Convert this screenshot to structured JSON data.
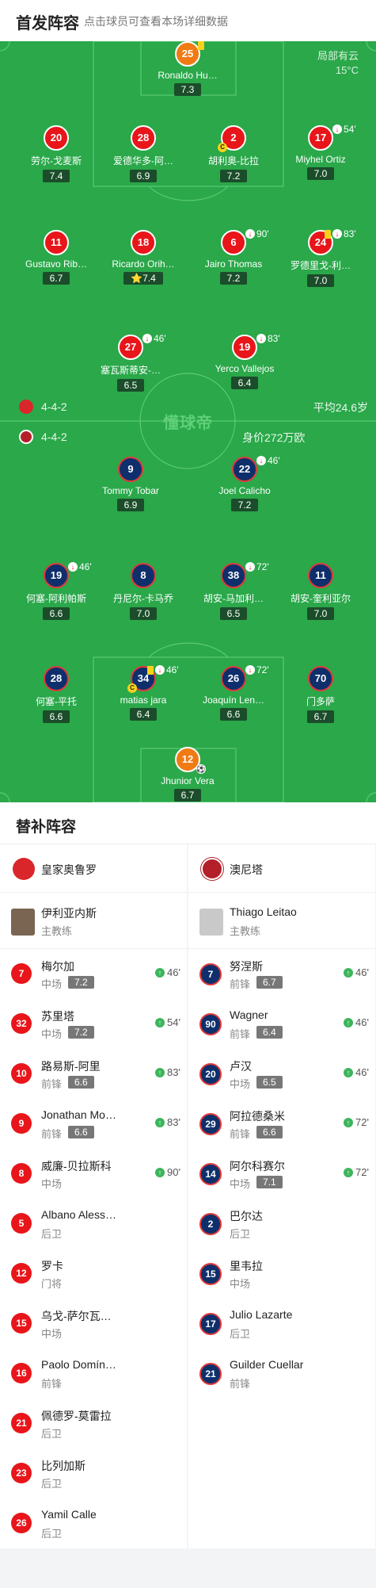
{
  "header": {
    "title": "首发阵容",
    "subtitle": "点击球员可查看本场详细数据"
  },
  "weather": {
    "line1": "局部有云",
    "line2": "15°C"
  },
  "home": {
    "formation": "4-4-2",
    "avg_age": "平均24.6岁",
    "crest_color": "#d9262b",
    "players": [
      {
        "num": "25",
        "name": "Ronaldo Hu…",
        "rating": "7.3",
        "color": "orange",
        "card": "yellow"
      },
      {
        "num": "20",
        "name": "劳尔-戈麦斯",
        "rating": "7.4",
        "color": "red"
      },
      {
        "num": "28",
        "name": "爱德华多-阿…",
        "rating": "6.9",
        "color": "red"
      },
      {
        "num": "2",
        "name": "胡利奥-比拉",
        "rating": "7.2",
        "color": "red",
        "captain": "C"
      },
      {
        "num": "17",
        "name": "Miyhel Ortiz",
        "rating": "7.0",
        "color": "red",
        "sub": "54'"
      },
      {
        "num": "11",
        "name": "Gustavo Rib…",
        "rating": "6.7",
        "color": "red"
      },
      {
        "num": "18",
        "name": "Ricardo Orih…",
        "rating": "7.4",
        "color": "red",
        "star": "⭐"
      },
      {
        "num": "6",
        "name": "Jairo Thomas",
        "rating": "7.2",
        "color": "red",
        "sub": "90'"
      },
      {
        "num": "24",
        "name": "罗德里戈-利…",
        "rating": "7.0",
        "color": "red",
        "sub": "83'",
        "card": "yellow"
      },
      {
        "num": "27",
        "name": "塞瓦斯蒂安-…",
        "rating": "6.5",
        "color": "red",
        "sub": "46'"
      },
      {
        "num": "19",
        "name": "Yerco Vallejos",
        "rating": "6.4",
        "color": "red",
        "sub": "83'"
      }
    ]
  },
  "away": {
    "formation": "4-4-2",
    "value": "身价272万欧",
    "crest_color": "#b3202a",
    "players": [
      {
        "num": "9",
        "name": "Tommy Tobar",
        "rating": "6.9"
      },
      {
        "num": "22",
        "name": "Joel Calicho",
        "rating": "7.2",
        "sub": "46'"
      },
      {
        "num": "19",
        "name": "何塞-阿利帕斯",
        "rating": "6.6",
        "sub": "46'"
      },
      {
        "num": "8",
        "name": "丹尼尔-卡马乔",
        "rating": "7.0"
      },
      {
        "num": "38",
        "name": "胡安-马加利…",
        "rating": "6.5",
        "sub": "72'"
      },
      {
        "num": "11",
        "name": "胡安-奎利亚尔",
        "rating": "7.0"
      },
      {
        "num": "28",
        "name": "何塞-平托",
        "rating": "6.6"
      },
      {
        "num": "34",
        "name": "matias jara",
        "rating": "6.4",
        "sub": "46'",
        "captain": "C",
        "card": "yellow"
      },
      {
        "num": "26",
        "name": "Joaquín Len…",
        "rating": "6.6",
        "sub": "72'"
      },
      {
        "num": "70",
        "name": "门多萨",
        "rating": "6.7"
      },
      {
        "num": "12",
        "name": "Jhunior Vera",
        "rating": "6.7",
        "color": "orange"
      }
    ]
  },
  "watermark": "懂球帝",
  "subs": {
    "title": "替补阵容",
    "home_team": "皇家奥鲁罗",
    "away_team": "澳尼塔",
    "home_coach": {
      "name": "伊利亚内斯",
      "role": "主教练"
    },
    "away_coach": {
      "name": "Thiago Leitao",
      "role": "主教练"
    },
    "home": [
      {
        "num": "7",
        "name": "梅尔加",
        "pos": "中场",
        "rating": "7.2",
        "event": "46'"
      },
      {
        "num": "32",
        "name": "苏里塔",
        "pos": "中场",
        "rating": "7.2",
        "event": "54'"
      },
      {
        "num": "10",
        "name": "路易斯-阿里",
        "pos": "前锋",
        "rating": "6.6",
        "event": "83'"
      },
      {
        "num": "9",
        "name": "Jonathan Mo…",
        "pos": "前锋",
        "rating": "6.6",
        "event": "83'"
      },
      {
        "num": "8",
        "name": "威廉-贝拉斯科",
        "pos": "中场",
        "rating": "",
        "event": "90'"
      },
      {
        "num": "5",
        "name": "Albano Aless…",
        "pos": "后卫",
        "rating": "",
        "event": ""
      },
      {
        "num": "12",
        "name": "罗卡",
        "pos": "门将",
        "rating": "",
        "event": ""
      },
      {
        "num": "15",
        "name": "乌戈-萨尔瓦…",
        "pos": "中场",
        "rating": "",
        "event": ""
      },
      {
        "num": "16",
        "name": "Paolo Domín…",
        "pos": "前锋",
        "rating": "",
        "event": ""
      },
      {
        "num": "21",
        "name": "佩德罗-莫雷拉",
        "pos": "后卫",
        "rating": "",
        "event": ""
      },
      {
        "num": "23",
        "name": "比列加斯",
        "pos": "后卫",
        "rating": "",
        "event": ""
      },
      {
        "num": "26",
        "name": "Yamil Calle",
        "pos": "后卫",
        "rating": "",
        "event": ""
      }
    ],
    "away": [
      {
        "num": "7",
        "name": "努涅斯",
        "pos": "前锋",
        "rating": "6.7",
        "event": "46'"
      },
      {
        "num": "90",
        "name": "Wagner",
        "pos": "前锋",
        "rating": "6.4",
        "event": "46'"
      },
      {
        "num": "20",
        "name": "卢汉",
        "pos": "中场",
        "rating": "6.5",
        "event": "46'"
      },
      {
        "num": "29",
        "name": "阿拉德桑米",
        "pos": "前锋",
        "rating": "6.6",
        "event": "72'"
      },
      {
        "num": "14",
        "name": "阿尔科赛尔",
        "pos": "中场",
        "rating": "7.1",
        "event": "72'"
      },
      {
        "num": "2",
        "name": "巴尔达",
        "pos": "后卫",
        "rating": "",
        "event": ""
      },
      {
        "num": "15",
        "name": "里韦拉",
        "pos": "中场",
        "rating": "",
        "event": ""
      },
      {
        "num": "17",
        "name": "Julio Lazarte",
        "pos": "后卫",
        "rating": "",
        "event": ""
      },
      {
        "num": "21",
        "name": "Guilder Cuellar",
        "pos": "前锋",
        "rating": "",
        "event": ""
      }
    ]
  }
}
